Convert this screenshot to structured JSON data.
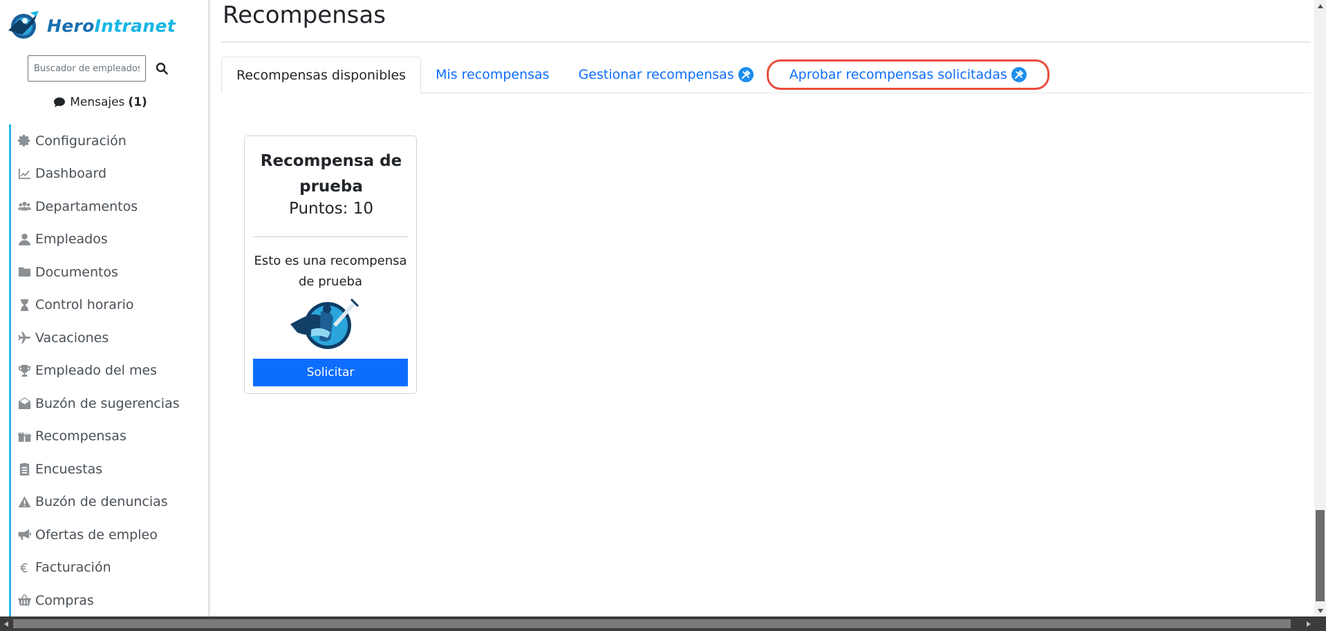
{
  "brand": {
    "name_part1": "Hero",
    "name_part2": "Intranet"
  },
  "search": {
    "placeholder": "Buscador de empleados..."
  },
  "messages": {
    "label": "Mensajes",
    "count": "(1)"
  },
  "sidebar": {
    "items": [
      {
        "label": "Configuración",
        "icon": "gear-icon"
      },
      {
        "label": "Dashboard",
        "icon": "chart-line-icon"
      },
      {
        "label": "Departamentos",
        "icon": "users-icon"
      },
      {
        "label": "Empleados",
        "icon": "user-icon"
      },
      {
        "label": "Documentos",
        "icon": "folder-icon"
      },
      {
        "label": "Control horario",
        "icon": "hourglass-icon"
      },
      {
        "label": "Vacaciones",
        "icon": "plane-icon"
      },
      {
        "label": "Empleado del mes",
        "icon": "trophy-icon"
      },
      {
        "label": "Buzón de sugerencias",
        "icon": "envelope-open-icon"
      },
      {
        "label": "Recompensas",
        "icon": "gifts-icon"
      },
      {
        "label": "Encuestas",
        "icon": "clipboard-list-icon"
      },
      {
        "label": "Buzón de denuncias",
        "icon": "warning-icon"
      },
      {
        "label": "Ofertas de empleo",
        "icon": "bullhorn-icon"
      },
      {
        "label": "Facturación",
        "icon": "euro-icon"
      },
      {
        "label": "Compras",
        "icon": "basket-icon"
      }
    ]
  },
  "main": {
    "title": "Recompensas",
    "tabs": [
      {
        "label": "Recompensas disponibles",
        "active": true
      },
      {
        "label": "Mis recompensas"
      },
      {
        "label": "Gestionar recompensas"
      },
      {
        "label": "Aprobar recompensas solicitadas",
        "highlighted": true
      }
    ]
  },
  "card": {
    "title": "Recompensa de prueba",
    "points": "Puntos: 10",
    "description": "Esto es una recompensa de prueba",
    "button": "Solicitar"
  },
  "colors": {
    "accent": "#0d6efd",
    "sidebar_border": "#29b6e8",
    "highlight": "#e74c3c"
  }
}
